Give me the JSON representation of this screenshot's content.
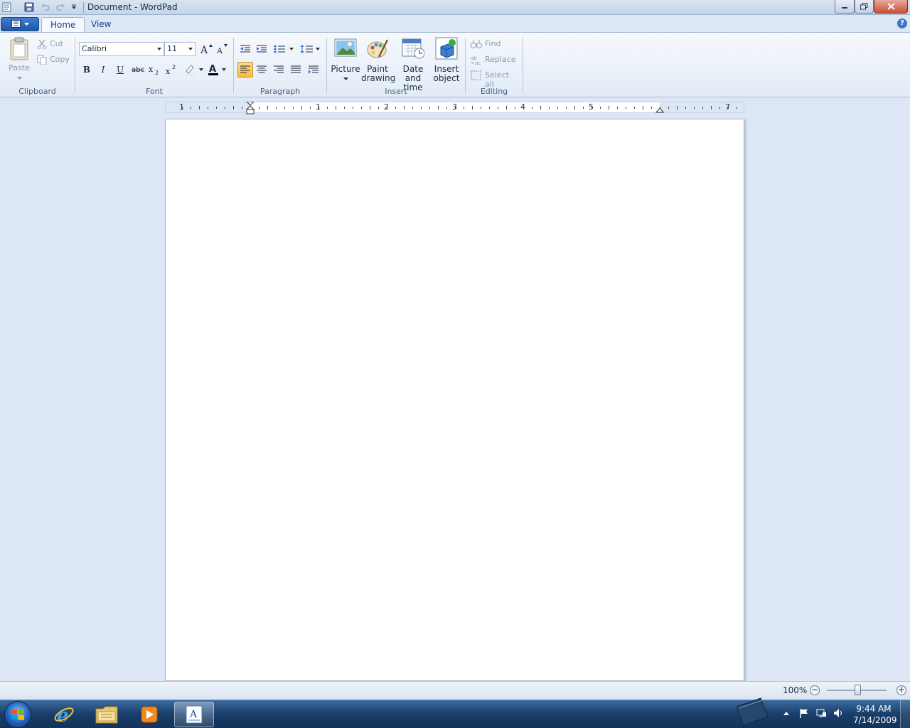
{
  "window": {
    "title": "Document - WordPad"
  },
  "tabs": [
    {
      "label": "Home"
    },
    {
      "label": "View"
    }
  ],
  "ribbon": {
    "clipboard": {
      "paste": "Paste",
      "cut": "Cut",
      "copy": "Copy",
      "group": "Clipboard"
    },
    "font": {
      "family": "Calibri",
      "size": "11",
      "group": "Font",
      "strikethrough_label": "abc",
      "bold": "B",
      "italic": "I",
      "underline": "U"
    },
    "paragraph": {
      "group": "Paragraph"
    },
    "insert": {
      "picture": "Picture",
      "paint_line1": "Paint",
      "paint_line2": "drawing",
      "datetime_line1": "Date and",
      "datetime_line2": "time",
      "object_line1": "Insert",
      "object_line2": "object",
      "group": "Insert"
    },
    "editing": {
      "find": "Find",
      "replace": "Replace",
      "select_all": "Select all",
      "group": "Editing"
    },
    "help": "?"
  },
  "ruler": {
    "numbers": [
      "1",
      "1",
      "2",
      "3",
      "4",
      "5",
      "7"
    ]
  },
  "statusbar": {
    "zoom": "100%",
    "zoom_level_percent": 100,
    "zoom_out": "−",
    "zoom_in": "+"
  },
  "taskbar": {
    "time": "9:44 AM",
    "date": "7/14/2009"
  },
  "colors": {
    "accent": "#1d55a8",
    "taskbar": "#183e6a",
    "ribbon_bg": "#e2ebf6",
    "workspace": "#dce6f4"
  }
}
